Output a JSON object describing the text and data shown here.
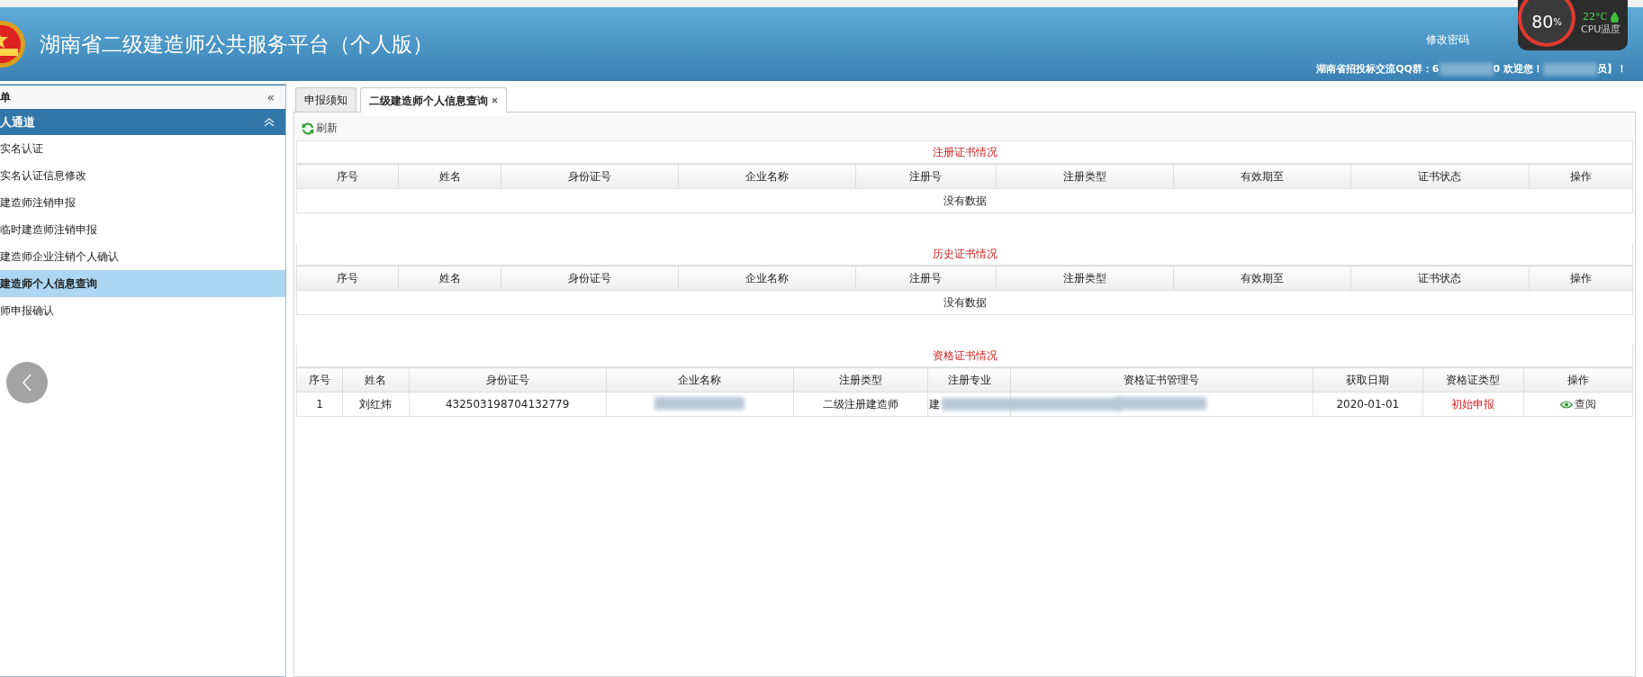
{
  "header": {
    "title": "湖南省二级建造师公共服务平台（个人版）",
    "change_password": "修改密码",
    "notice_parts": [
      {
        "kind": "text",
        "text": "湖南省招投标交流QQ群：6"
      },
      {
        "kind": "redacted"
      },
      {
        "kind": "text",
        "text": "0 欢迎您！"
      },
      {
        "kind": "redacted"
      },
      {
        "kind": "text",
        "text": "员】！"
      }
    ]
  },
  "cpu_widget": {
    "usage": "80",
    "unit": "%",
    "temperature": "22°C",
    "label": "CPU温度"
  },
  "sidebar": {
    "title": "单",
    "collapse_icon": "«",
    "group": {
      "label": "人通道",
      "expanded": true,
      "items": [
        {
          "label": "实名认证",
          "selected": false
        },
        {
          "label": "实名认证信息修改",
          "selected": false
        },
        {
          "label": "建造师注销申报",
          "selected": false
        },
        {
          "label": "临时建造师注销申报",
          "selected": false
        },
        {
          "label": "建造师企业注销个人确认",
          "selected": false
        },
        {
          "label": "建造师个人信息查询",
          "selected": true
        },
        {
          "label": "师申报确认",
          "selected": false
        }
      ]
    }
  },
  "tabs": [
    {
      "label": "申报须知",
      "selected": false,
      "closable": false
    },
    {
      "label": "二级建造师个人信息查询",
      "selected": true,
      "closable": true
    }
  ],
  "toolbar": {
    "refresh": "刷新"
  },
  "sections": [
    {
      "title": "注册证书情况",
      "columns": [
        "序号",
        "姓名",
        "身份证号",
        "企业名称",
        "注册号",
        "注册类型",
        "有效期至",
        "证书状态",
        "操作"
      ],
      "empty_text": "没有数据"
    },
    {
      "title": "历史证书情况",
      "columns": [
        "序号",
        "姓名",
        "身份证号",
        "企业名称",
        "注册号",
        "注册类型",
        "有效期至",
        "证书状态",
        "操作"
      ],
      "empty_text": "没有数据"
    },
    {
      "title": "资格证书情况",
      "columns": [
        "序号",
        "姓名",
        "身份证号",
        "企业名称",
        "注册类型",
        "注册专业",
        "资格证书管理号",
        "获取日期",
        "资格证类型",
        "操作"
      ],
      "rows": [
        [
          {
            "kind": "text",
            "text": "1"
          },
          {
            "kind": "text",
            "text": "刘红炜"
          },
          {
            "kind": "text",
            "text": "432503198704132779"
          },
          {
            "kind": "redacted"
          },
          {
            "kind": "text",
            "text": "二级注册建造师"
          },
          {
            "kind": "partial",
            "text": "建"
          },
          {
            "kind": "redacted"
          },
          {
            "kind": "text",
            "text": "2020-01-01"
          },
          {
            "kind": "status",
            "text": "初始申报"
          },
          {
            "kind": "link",
            "text": "查阅"
          }
        ]
      ]
    }
  ]
}
